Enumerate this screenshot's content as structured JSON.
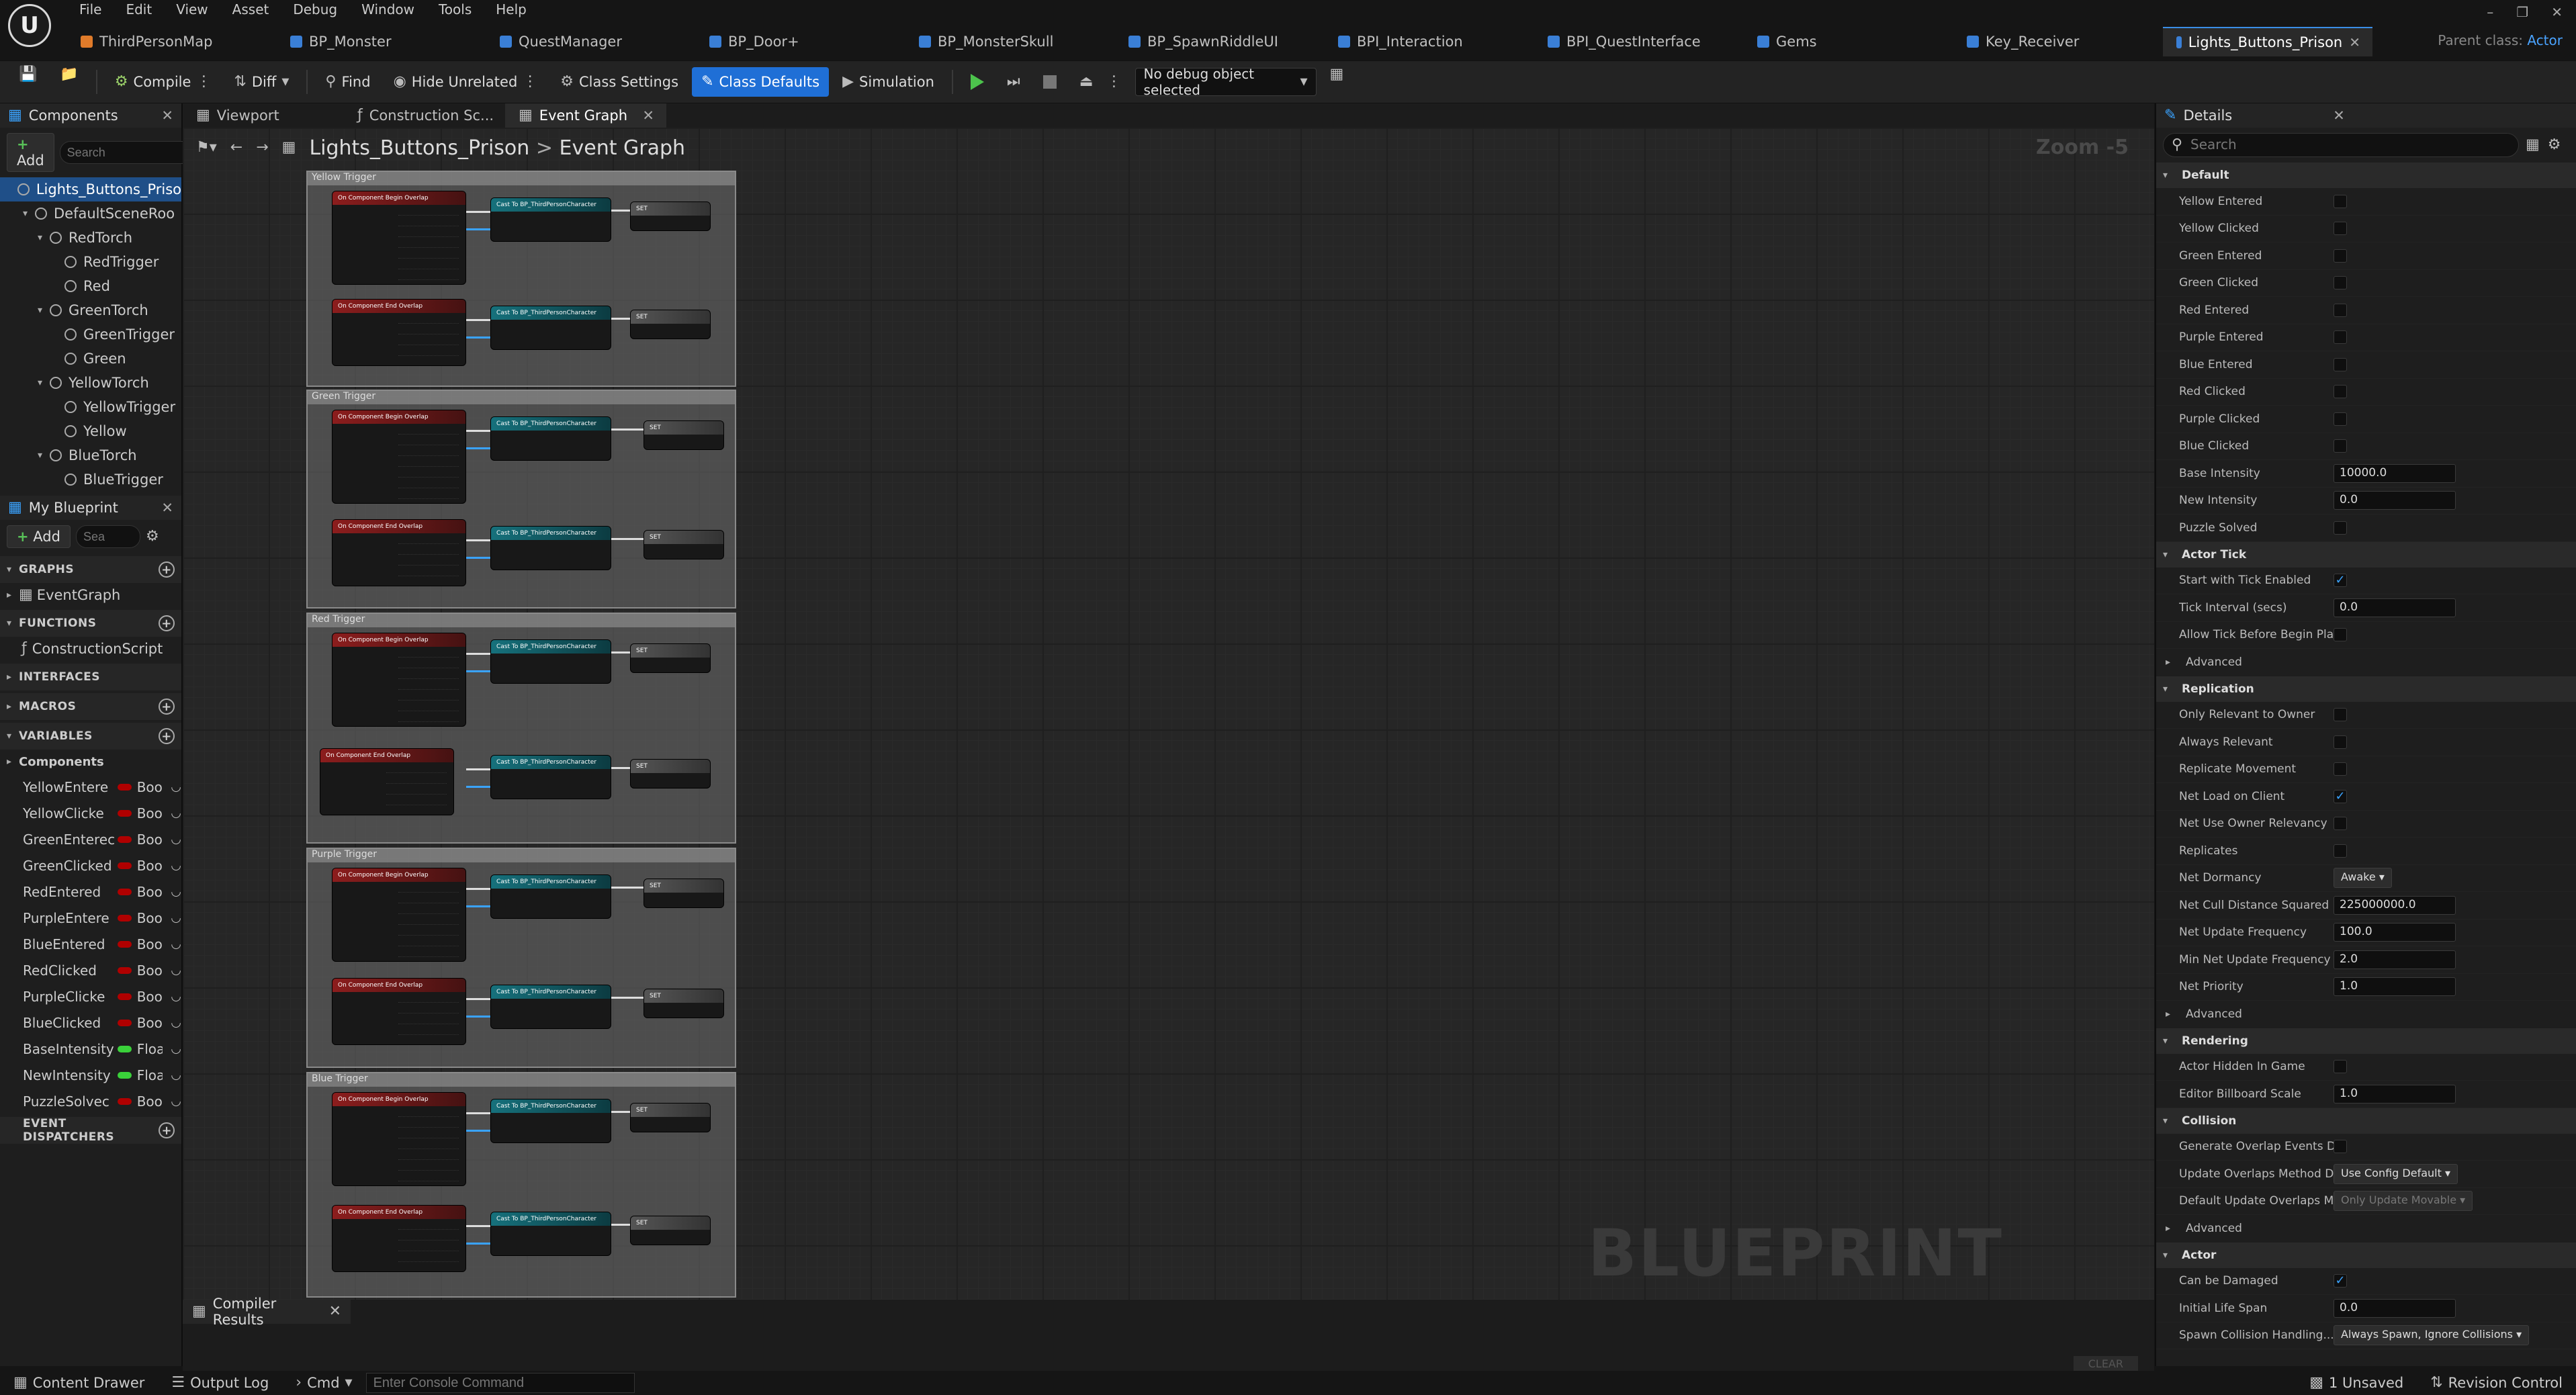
{
  "app": {
    "logo_text": "U"
  },
  "menu": [
    "File",
    "Edit",
    "View",
    "Asset",
    "Debug",
    "Window",
    "Tools",
    "Help"
  ],
  "doc_tabs": [
    {
      "label": "ThirdPersonMap",
      "color": "#e07b2a",
      "active": false
    },
    {
      "label": "BP_Monster",
      "color": "#3a7fd6",
      "active": false
    },
    {
      "label": "QuestManager",
      "color": "#3a7fd6",
      "active": false
    },
    {
      "label": "BP_Door+",
      "color": "#3a7fd6",
      "active": false
    },
    {
      "label": "BP_MonsterSkull",
      "color": "#3a7fd6",
      "active": false
    },
    {
      "label": "BP_SpawnRiddleUI",
      "color": "#3a7fd6",
      "active": false
    },
    {
      "label": "BPI_Interaction",
      "color": "#3a7fd6",
      "active": false
    },
    {
      "label": "BPI_QuestInterface",
      "color": "#3a7fd6",
      "active": false
    },
    {
      "label": "Gems",
      "color": "#3a7fd6",
      "active": false
    },
    {
      "label": "Key_Receiver",
      "color": "#3a7fd6",
      "active": false
    },
    {
      "label": "Lights_Buttons_Prison",
      "color": "#3a7fd6",
      "active": true
    }
  ],
  "parent_class": {
    "label": "Parent class:",
    "value": "Actor"
  },
  "toolbar": {
    "compile": "Compile",
    "diff": "Diff",
    "find": "Find",
    "hide_unrelated": "Hide Unrelated",
    "class_settings": "Class Settings",
    "class_defaults": "Class Defaults",
    "simulation": "Simulation",
    "debug_object": "No debug object selected"
  },
  "components_panel": {
    "title": "Components",
    "add": "Add",
    "search_placeholder": "Search",
    "tree": [
      {
        "label": "Lights_Buttons_Priso",
        "indent": 0,
        "selected": true
      },
      {
        "label": "DefaultSceneRoo",
        "indent": 1,
        "expand": true
      },
      {
        "label": "RedTorch",
        "indent": 2,
        "expand": true
      },
      {
        "label": "RedTrigger",
        "indent": 3
      },
      {
        "label": "Red",
        "indent": 3
      },
      {
        "label": "GreenTorch",
        "indent": 2,
        "expand": true
      },
      {
        "label": "GreenTrigger",
        "indent": 3
      },
      {
        "label": "Green",
        "indent": 3
      },
      {
        "label": "YellowTorch",
        "indent": 2,
        "expand": true
      },
      {
        "label": "YellowTrigger",
        "indent": 3
      },
      {
        "label": "Yellow",
        "indent": 3
      },
      {
        "label": "BlueTorch",
        "indent": 2,
        "expand": true
      },
      {
        "label": "BlueTrigger",
        "indent": 3
      }
    ]
  },
  "my_blueprint": {
    "title": "My Blueprint",
    "add": "Add",
    "search_placeholder": "Sea",
    "graphs_header": "GRAPHS",
    "event_graph": "EventGraph",
    "functions_header": "FUNCTIONS",
    "construction_script": "ConstructionScript",
    "interfaces_header": "INTERFACES",
    "macros_header": "MACROS",
    "variables_header": "VARIABLES",
    "components_group": "Components",
    "variables": [
      {
        "name": "YellowEntere",
        "type": "Boole",
        "color": "#b00000"
      },
      {
        "name": "YellowClicke",
        "type": "Boole",
        "color": "#b00000"
      },
      {
        "name": "GreenEnterec",
        "type": "Boole",
        "color": "#b00000"
      },
      {
        "name": "GreenClicked",
        "type": "Boole",
        "color": "#b00000"
      },
      {
        "name": "RedEntered",
        "type": "Boole",
        "color": "#b00000"
      },
      {
        "name": "PurpleEntere",
        "type": "Boole",
        "color": "#b00000"
      },
      {
        "name": "BlueEntered",
        "type": "Boole",
        "color": "#b00000"
      },
      {
        "name": "RedClicked",
        "type": "Boole",
        "color": "#b00000"
      },
      {
        "name": "PurpleClicke",
        "type": "Boole",
        "color": "#b00000"
      },
      {
        "name": "BlueClicked",
        "type": "Boole",
        "color": "#b00000"
      },
      {
        "name": "BaseIntensity",
        "type": "Float",
        "color": "#3ad13a"
      },
      {
        "name": "NewIntensity",
        "type": "Float",
        "color": "#3ad13a"
      },
      {
        "name": "PuzzleSolvec",
        "type": "Boole",
        "color": "#b00000"
      }
    ],
    "event_dispatchers_header": "EVENT DISPATCHERS"
  },
  "graph_tabs": [
    {
      "label": "Viewport",
      "active": false
    },
    {
      "label": "Construction Sc...",
      "active": false
    },
    {
      "label": "Event Graph",
      "active": true
    }
  ],
  "graph": {
    "breadcrumb_root": "Lights_Buttons_Prison",
    "breadcrumb_sep": ">",
    "breadcrumb_leaf": "Event Graph",
    "zoom": "Zoom -5",
    "watermark": "BLUEPRINT",
    "comments": [
      {
        "title": "Yellow Trigger"
      },
      {
        "title": "Green Trigger"
      },
      {
        "title": "Red Trigger"
      },
      {
        "title": "Purple Trigger"
      },
      {
        "title": "Blue Trigger"
      }
    ],
    "node_labels": {
      "begin": "On Component Begin Overlap",
      "end": "On Component End Overlap",
      "cast": "Cast To BP_ThirdPersonCharacter",
      "set": "SET"
    }
  },
  "compiler": {
    "title": "Compiler Results",
    "clear": "CLEAR"
  },
  "details": {
    "title": "Details",
    "search_placeholder": "Search",
    "sections": [
      {
        "title": "Default",
        "rows": [
          {
            "label": "Yellow Entered",
            "kind": "check",
            "value": false
          },
          {
            "label": "Yellow Clicked",
            "kind": "check",
            "value": false
          },
          {
            "label": "Green Entered",
            "kind": "check",
            "value": false
          },
          {
            "label": "Green Clicked",
            "kind": "check",
            "value": false
          },
          {
            "label": "Red Entered",
            "kind": "check",
            "value": false
          },
          {
            "label": "Purple Entered",
            "kind": "check",
            "value": false
          },
          {
            "label": "Blue Entered",
            "kind": "check",
            "value": false
          },
          {
            "label": "Red Clicked",
            "kind": "check",
            "value": false
          },
          {
            "label": "Purple Clicked",
            "kind": "check",
            "value": false
          },
          {
            "label": "Blue Clicked",
            "kind": "check",
            "value": false
          },
          {
            "label": "Base Intensity",
            "kind": "num",
            "value": "10000.0"
          },
          {
            "label": "New Intensity",
            "kind": "num",
            "value": "0.0"
          },
          {
            "label": "Puzzle Solved",
            "kind": "check",
            "value": false
          }
        ]
      },
      {
        "title": "Actor Tick",
        "rows": [
          {
            "label": "Start with Tick Enabled",
            "kind": "check",
            "value": true
          },
          {
            "label": "Tick Interval (secs)",
            "kind": "num",
            "value": "0.0"
          },
          {
            "label": "Allow Tick Before Begin Play",
            "kind": "check",
            "value": false
          },
          {
            "label": "Advanced",
            "kind": "adv"
          }
        ]
      },
      {
        "title": "Replication",
        "rows": [
          {
            "label": "Only Relevant to Owner",
            "kind": "check",
            "value": false
          },
          {
            "label": "Always Relevant",
            "kind": "check",
            "value": false
          },
          {
            "label": "Replicate Movement",
            "kind": "check",
            "value": false
          },
          {
            "label": "Net Load on Client",
            "kind": "check",
            "value": true
          },
          {
            "label": "Net Use Owner Relevancy",
            "kind": "check",
            "value": false
          },
          {
            "label": "Replicates",
            "kind": "check",
            "value": false
          },
          {
            "label": "Net Dormancy",
            "kind": "combo",
            "value": "Awake"
          },
          {
            "label": "Net Cull Distance Squared",
            "kind": "num",
            "value": "225000000.0"
          },
          {
            "label": "Net Update Frequency",
            "kind": "num",
            "value": "100.0"
          },
          {
            "label": "Min Net Update Frequency",
            "kind": "num",
            "value": "2.0"
          },
          {
            "label": "Net Priority",
            "kind": "num",
            "value": "1.0"
          },
          {
            "label": "Advanced",
            "kind": "adv"
          }
        ]
      },
      {
        "title": "Rendering",
        "rows": [
          {
            "label": "Actor Hidden In Game",
            "kind": "check",
            "value": false
          },
          {
            "label": "Editor Billboard Scale",
            "kind": "num",
            "value": "1.0"
          }
        ]
      },
      {
        "title": "Collision",
        "rows": [
          {
            "label": "Generate Overlap Events D...",
            "kind": "check",
            "value": false
          },
          {
            "label": "Update Overlaps Method D...",
            "kind": "combo",
            "value": "Use Config Default"
          },
          {
            "label": "Default Update Overlaps M...",
            "kind": "combo_dim",
            "value": "Only Update Movable"
          },
          {
            "label": "Advanced",
            "kind": "adv"
          }
        ]
      },
      {
        "title": "Actor",
        "rows": [
          {
            "label": "Can be Damaged",
            "kind": "check",
            "value": true
          },
          {
            "label": "Initial Life Span",
            "kind": "num",
            "value": "0.0"
          },
          {
            "label": "Spawn Collision Handling...",
            "kind": "combo",
            "value": "Always Spawn, Ignore Collisions"
          }
        ]
      }
    ]
  },
  "statusbar": {
    "content_drawer": "Content Drawer",
    "output_log": "Output Log",
    "cmd": "Cmd",
    "console_placeholder": "Enter Console Command",
    "unsaved": "1 Unsaved",
    "revision_control": "Revision Control"
  }
}
